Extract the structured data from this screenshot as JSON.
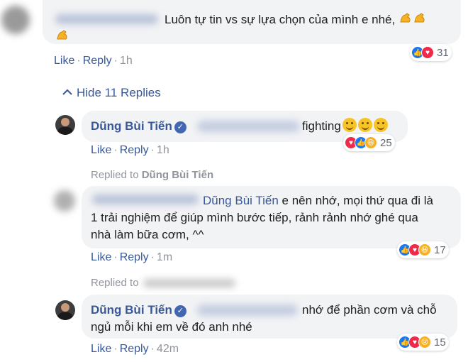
{
  "thread": {
    "top_comment": {
      "text": "Luôn tự tin vs sự lựa chọn của mình e nhé,",
      "like": "Like",
      "reply": "Reply",
      "time": "1h",
      "reaction_count": "31"
    },
    "hide_replies": "Hide 11 Replies",
    "reply1": {
      "author": "Dũng Bùi Tiến",
      "text": "fighting",
      "like": "Like",
      "reply": "Reply",
      "time": "1h",
      "reaction_count": "25"
    },
    "replied_to_1": {
      "prefix": "Replied to",
      "target": "Dũng Bùi Tiến"
    },
    "reply2": {
      "mention": "Dũng Bùi Tiến",
      "line1": "e nên nhớ, mọi thứ qua đi là",
      "line2": "1 trải nghiệm để giúp mình bước tiếp, rảnh rảnh nhớ ghé qua",
      "line3": "nhà làm bữa cơm, ^^",
      "like": "Like",
      "reply": "Reply",
      "time": "1m",
      "reaction_count": "17"
    },
    "replied_to_2": {
      "prefix": "Replied to"
    },
    "reply3": {
      "author": "Dũng Bùi Tiến",
      "line1": "nhớ để phần cơm và chỗ",
      "line2": "ngủ mỗi khi em về đó anh nhé",
      "like": "Like",
      "reply": "Reply",
      "time": "42m",
      "reaction_count": "15"
    }
  },
  "colors": {
    "link": "#385898",
    "bubble": "#f2f3f5",
    "muted": "#90949c",
    "like": "#1877f2",
    "love": "#f0284a",
    "haha": "#f7b125"
  }
}
